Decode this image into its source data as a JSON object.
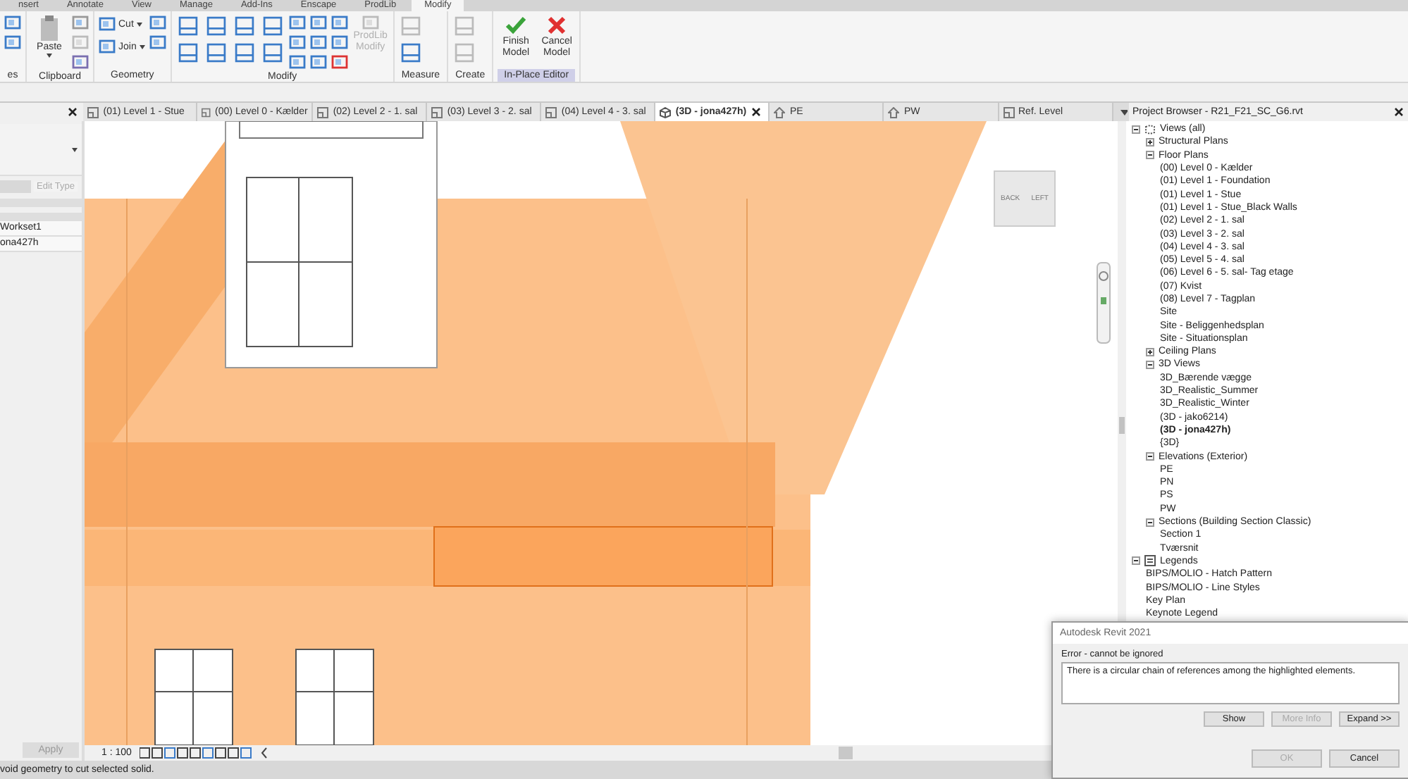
{
  "ribbon_tabs": [
    {
      "label": "nsert",
      "selected": false
    },
    {
      "label": "Annotate",
      "selected": false
    },
    {
      "label": "View",
      "selected": false
    },
    {
      "label": "Manage",
      "selected": false
    },
    {
      "label": "Add-Ins",
      "selected": false
    },
    {
      "label": "Enscape",
      "selected": false
    },
    {
      "label": "ProdLib",
      "selected": false
    },
    {
      "label": "Modify",
      "selected": true
    }
  ],
  "ribbon_groups": [
    {
      "label": "es",
      "highlighted": false
    },
    {
      "label": "Clipboard",
      "highlighted": false,
      "tools": [
        {
          "label": "Paste",
          "disabled": false
        }
      ]
    },
    {
      "label": "Geometry",
      "highlighted": false,
      "tools": [
        {
          "label": "Cut",
          "disabled": false
        },
        {
          "label": "Join",
          "disabled": false
        }
      ]
    },
    {
      "label": "Modify",
      "highlighted": false,
      "tools": [
        {
          "label": "ProdLib Modify",
          "disabled": true
        }
      ]
    },
    {
      "label": "Measure",
      "highlighted": false
    },
    {
      "label": "Create",
      "highlighted": false
    },
    {
      "label": "In-Place Editor",
      "highlighted": true,
      "tools": [
        {
          "label": "Finish Model",
          "disabled": false
        },
        {
          "label": "Cancel Model",
          "disabled": false
        }
      ]
    }
  ],
  "properties": {
    "edit_type": {
      "label": "Edit Type",
      "disabled": true
    },
    "rows": [
      "Workset1",
      "ona427h"
    ],
    "apply": {
      "label": "Apply",
      "disabled": true
    }
  },
  "view_tabs": [
    {
      "label": "(01) Level 1 - Stue",
      "kind": "plan",
      "selected": false
    },
    {
      "label": "(00) Level 0 - Kælder",
      "kind": "plan",
      "selected": false
    },
    {
      "label": "(02) Level 2 - 1. sal",
      "kind": "plan",
      "selected": false
    },
    {
      "label": "(03) Level 3 - 2. sal",
      "kind": "plan",
      "selected": false
    },
    {
      "label": "(04) Level 4 - 3. sal",
      "kind": "plan",
      "selected": false
    },
    {
      "label": "(3D - jona427h)",
      "kind": "cube",
      "selected": true
    },
    {
      "label": "PE",
      "kind": "elevation",
      "selected": false
    },
    {
      "label": "PW",
      "kind": "elevation",
      "selected": false
    },
    {
      "label": "Ref. Level",
      "kind": "plan",
      "selected": false
    }
  ],
  "view_cube": {
    "faces": [
      "BACK",
      "LEFT"
    ]
  },
  "view_control": {
    "scale": "1 : 100"
  },
  "project_browser": {
    "title": "Project Browser - R21_F21_SC_G6.rvt",
    "tree": [
      {
        "label": "Views (all)",
        "expanded": true,
        "children": [
          {
            "label": "Structural Plans",
            "expanded": false
          },
          {
            "label": "Floor Plans",
            "expanded": true,
            "children": [
              {
                "label": "(00) Level 0 - Kælder"
              },
              {
                "label": "(01) Level 1 - Foundation"
              },
              {
                "label": "(01) Level 1 - Stue"
              },
              {
                "label": "(01) Level 1 - Stue_Black Walls"
              },
              {
                "label": "(02) Level 2 - 1. sal"
              },
              {
                "label": "(03) Level 3 - 2. sal"
              },
              {
                "label": "(04) Level 4 - 3. sal"
              },
              {
                "label": "(05) Level 5 - 4. sal"
              },
              {
                "label": "(06) Level 6 - 5. sal-  Tag etage"
              },
              {
                "label": "(07) Kvist"
              },
              {
                "label": "(08) Level 7 - Tagplan"
              },
              {
                "label": "Site"
              },
              {
                "label": "Site - Beliggenhedsplan"
              },
              {
                "label": "Site - Situationsplan"
              }
            ]
          },
          {
            "label": "Ceiling Plans",
            "expanded": false
          },
          {
            "label": "3D Views",
            "expanded": true,
            "children": [
              {
                "label": "3D_Bærende vægge",
                "active": false
              },
              {
                "label": "3D_Realistic_Summer",
                "active": false
              },
              {
                "label": "3D_Realistic_Winter",
                "active": false
              },
              {
                "label": "(3D - jako6214)",
                "active": false
              },
              {
                "label": "(3D - jona427h)",
                "active": true
              },
              {
                "label": "{3D}",
                "active": false
              }
            ]
          },
          {
            "label": "Elevations (Exterior)",
            "expanded": true,
            "children": [
              {
                "label": "PE"
              },
              {
                "label": "PN"
              },
              {
                "label": "PS"
              },
              {
                "label": "PW"
              }
            ]
          },
          {
            "label": "Sections (Building Section Classic)",
            "expanded": true,
            "children": [
              {
                "label": "Section 1"
              },
              {
                "label": "Tværsnit"
              }
            ]
          }
        ]
      },
      {
        "label": "Legends",
        "expanded": true,
        "children": [
          {
            "label": "BIPS/MOLIO - Hatch Pattern"
          },
          {
            "label": "BIPS/MOLIO - Line Styles"
          },
          {
            "label": "Key Plan"
          },
          {
            "label": "Keynote Legend"
          }
        ]
      }
    ]
  },
  "dialog": {
    "title": "Autodesk Revit 2021",
    "group": "Error - cannot be ignored",
    "message": "There is a circular chain of references among the highlighted elements.",
    "buttons": [
      {
        "label": "Show",
        "disabled": false
      },
      {
        "label": "More Info",
        "disabled": true
      },
      {
        "label": "Expand >>",
        "disabled": false
      }
    ],
    "footer_buttons": [
      {
        "label": "OK",
        "disabled": true
      },
      {
        "label": "Cancel",
        "disabled": false
      }
    ]
  },
  "status_bar": {
    "text": "void geometry to cut selected solid."
  }
}
